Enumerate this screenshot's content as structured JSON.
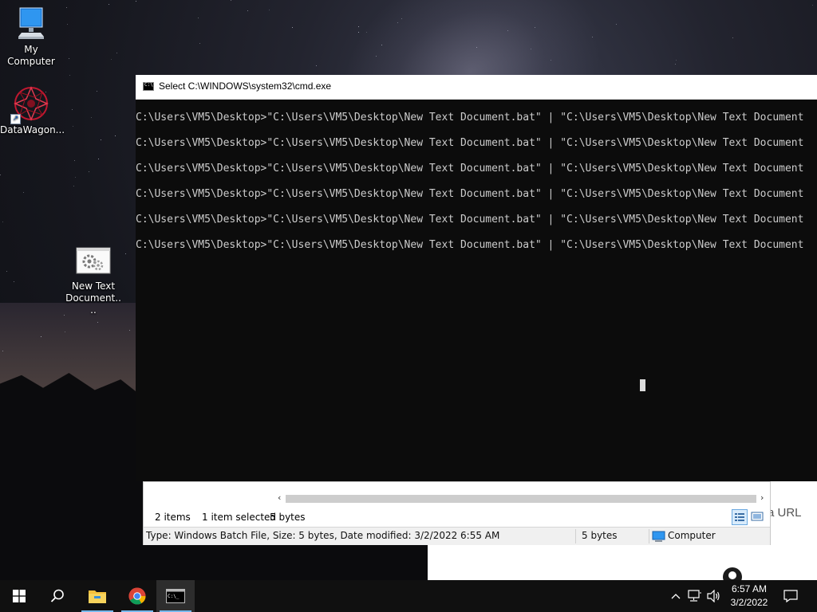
{
  "desktop": {
    "icons": [
      {
        "label": "My Computer",
        "icon": "computer-icon"
      },
      {
        "label": "DataWagon...",
        "icon": "datawagon-icon"
      },
      {
        "label": "New Text Document....",
        "icon": "batch-file-icon"
      }
    ]
  },
  "cmd": {
    "title": "Select C:\\WINDOWS\\system32\\cmd.exe",
    "lines": [
      "C:\\Users\\VM5\\Desktop>\"C:\\Users\\VM5\\Desktop\\New Text Document.bat\" | \"C:\\Users\\VM5\\Desktop\\New Text Document",
      "C:\\Users\\VM5\\Desktop>\"C:\\Users\\VM5\\Desktop\\New Text Document.bat\" | \"C:\\Users\\VM5\\Desktop\\New Text Document",
      "C:\\Users\\VM5\\Desktop>\"C:\\Users\\VM5\\Desktop\\New Text Document.bat\" | \"C:\\Users\\VM5\\Desktop\\New Text Document",
      "C:\\Users\\VM5\\Desktop>\"C:\\Users\\VM5\\Desktop\\New Text Document.bat\" | \"C:\\Users\\VM5\\Desktop\\New Text Document",
      "C:\\Users\\VM5\\Desktop>\"C:\\Users\\VM5\\Desktop\\New Text Document.bat\" | \"C:\\Users\\VM5\\Desktop\\New Text Document",
      "C:\\Users\\VM5\\Desktop>\"C:\\Users\\VM5\\Desktop\\New Text Document.bat\" | \"C:\\Users\\VM5\\Desktop\\New Text Document"
    ]
  },
  "explorer": {
    "item_count": "2 items",
    "selected": "1 item selected",
    "selected_size": "5 bytes",
    "details": "Type: Windows Batch File, Size: 5 bytes, Date modified: 3/2/2022 6:55 AM",
    "size": "5 bytes",
    "location": "Computer"
  },
  "browser": {
    "url_hint": "a URL"
  },
  "taskbar": {
    "items": [
      "start-icon",
      "search-icon",
      "file-explorer-icon",
      "chrome-icon",
      "cmd-icon"
    ],
    "time": "6:57 AM",
    "date": "3/2/2022"
  },
  "colors": {
    "taskbar": "#101010",
    "cmd_bg": "#0c0c0c",
    "cmd_text": "#cccccc",
    "accent": "#76b9ed"
  }
}
